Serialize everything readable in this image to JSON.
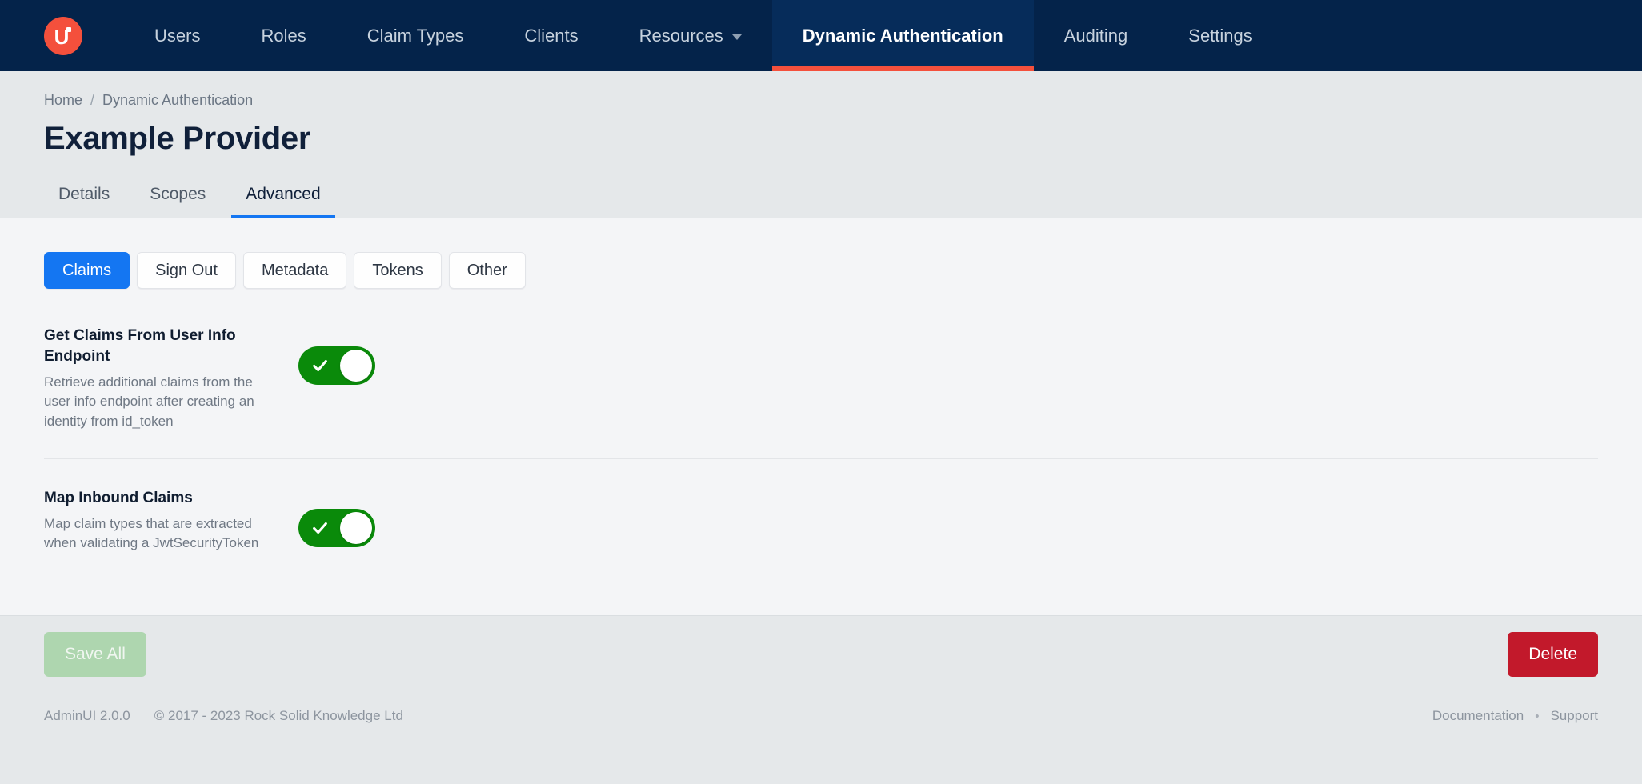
{
  "navbar": {
    "logo": {
      "glyph": "U",
      "icon": "adminui-logo-icon",
      "color": "#f4503c"
    },
    "items": [
      {
        "label": "Users",
        "active": false,
        "dropdown": false
      },
      {
        "label": "Roles",
        "active": false,
        "dropdown": false
      },
      {
        "label": "Claim Types",
        "active": false,
        "dropdown": false
      },
      {
        "label": "Clients",
        "active": false,
        "dropdown": false
      },
      {
        "label": "Resources",
        "active": false,
        "dropdown": true
      },
      {
        "label": "Dynamic Authentication",
        "active": true,
        "dropdown": false
      },
      {
        "label": "Auditing",
        "active": false,
        "dropdown": false
      },
      {
        "label": "Settings",
        "active": false,
        "dropdown": false
      }
    ]
  },
  "header": {
    "breadcrumb": {
      "home": "Home",
      "separator": "/",
      "current": "Dynamic Authentication"
    },
    "title": "Example Provider",
    "tabs": [
      {
        "label": "Details",
        "active": false
      },
      {
        "label": "Scopes",
        "active": false
      },
      {
        "label": "Advanced",
        "active": true
      }
    ]
  },
  "content": {
    "pills": [
      {
        "label": "Claims",
        "active": true
      },
      {
        "label": "Sign Out",
        "active": false
      },
      {
        "label": "Metadata",
        "active": false
      },
      {
        "label": "Tokens",
        "active": false
      },
      {
        "label": "Other",
        "active": false
      }
    ],
    "settings": [
      {
        "title": "Get Claims From User Info Endpoint",
        "description": "Retrieve additional claims from the user info endpoint after creating an identity from id_token",
        "toggle": {
          "state": "on",
          "icon": "check-icon"
        }
      },
      {
        "title": "Map Inbound Claims",
        "description": "Map claim types that are extracted when validating a JwtSecurityToken",
        "toggle": {
          "state": "on",
          "icon": "check-icon"
        }
      }
    ]
  },
  "actions": {
    "save_label": "Save All",
    "save_enabled": false,
    "delete_label": "Delete"
  },
  "footer": {
    "app_version": "AdminUI 2.0.0",
    "copyright": "© 2017 - 2023 Rock Solid Knowledge Ltd",
    "documentation": "Documentation",
    "separator": "•",
    "support": "Support"
  },
  "colors": {
    "navy": "#04234a",
    "accent_red": "#f4503c",
    "blue": "#1476f2",
    "green": "#0a8a0a",
    "crimson": "#c2192b"
  }
}
